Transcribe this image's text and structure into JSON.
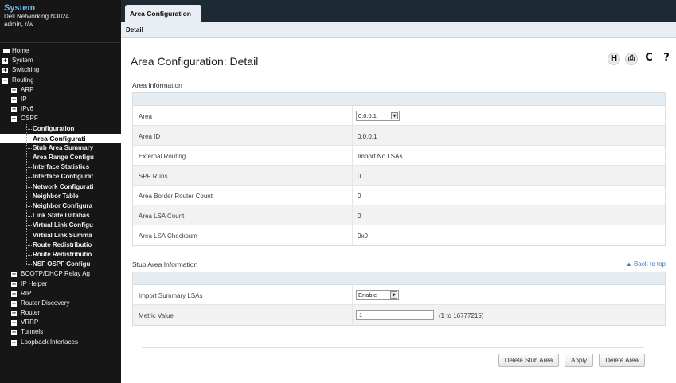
{
  "system": {
    "title": "System",
    "model": "Dell Networking N3024",
    "user": "admin, r/w"
  },
  "nav": {
    "items": [
      {
        "label": "Home",
        "expander": "",
        "level": 0
      },
      {
        "label": "System",
        "expander": "+",
        "level": 0
      },
      {
        "label": "Switching",
        "expander": "+",
        "level": 0
      },
      {
        "label": "Routing",
        "expander": "−",
        "level": 0
      },
      {
        "label": "ARP",
        "expander": "+",
        "level": 1
      },
      {
        "label": "IP",
        "expander": "+",
        "level": 1
      },
      {
        "label": "IPv6",
        "expander": "+",
        "level": 1
      },
      {
        "label": "OSPF",
        "expander": "−",
        "level": 1
      },
      {
        "label": "Configuration",
        "expander": "",
        "level": 2
      },
      {
        "label": "Area Configurati",
        "expander": "",
        "level": 2,
        "selected": true
      },
      {
        "label": "Stub Area Summary",
        "expander": "",
        "level": 2
      },
      {
        "label": "Area Range Configu",
        "expander": "",
        "level": 2
      },
      {
        "label": "Interface Statistics",
        "expander": "",
        "level": 2
      },
      {
        "label": "Interface Configurat",
        "expander": "",
        "level": 2
      },
      {
        "label": "Network Configurati",
        "expander": "",
        "level": 2
      },
      {
        "label": "Neighbor Table",
        "expander": "",
        "level": 2
      },
      {
        "label": "Neighbor Configura",
        "expander": "",
        "level": 2
      },
      {
        "label": "Link State Databas",
        "expander": "",
        "level": 2
      },
      {
        "label": "Virtual Link Configu",
        "expander": "",
        "level": 2
      },
      {
        "label": "Virtual Link Summa",
        "expander": "",
        "level": 2
      },
      {
        "label": "Route Redistributio",
        "expander": "",
        "level": 2
      },
      {
        "label": "Route Redistributio",
        "expander": "",
        "level": 2
      },
      {
        "label": "NSF OSPF Configu",
        "expander": "",
        "level": 2
      },
      {
        "label": "BOOTP/DHCP Relay Ag",
        "expander": "+",
        "level": 1
      },
      {
        "label": "IP Helper",
        "expander": "+",
        "level": 1
      },
      {
        "label": "RIP",
        "expander": "+",
        "level": 1
      },
      {
        "label": "Router Discovery",
        "expander": "+",
        "level": 1
      },
      {
        "label": "Router",
        "expander": "+",
        "level": 1
      },
      {
        "label": "VRRP",
        "expander": "+",
        "level": 1
      },
      {
        "label": "Tunnels",
        "expander": "+",
        "level": 1
      },
      {
        "label": "Loopback Interfaces",
        "expander": "+",
        "level": 1
      }
    ]
  },
  "tabs": {
    "main": "Area Configuration",
    "sub": "Detail"
  },
  "page": {
    "title": "Area Configuration: Detail"
  },
  "toolbar": {
    "icons": [
      "save-icon",
      "print-icon",
      "refresh-icon",
      "help-icon"
    ],
    "glyphs": [
      "H",
      "⎙",
      "C",
      "?"
    ]
  },
  "area_info": {
    "title": "Area Information",
    "rows": [
      {
        "label": "Area",
        "value": "0.0.0.1",
        "type": "select"
      },
      {
        "label": "Area ID",
        "value": "0.0.0.1"
      },
      {
        "label": "External Routing",
        "value": "Import No LSAs"
      },
      {
        "label": "SPF Runs",
        "value": "0"
      },
      {
        "label": "Area Border Router Count",
        "value": "0"
      },
      {
        "label": "Area LSA Count",
        "value": "0"
      },
      {
        "label": "Area LSA Checksum",
        "value": "0x0"
      }
    ]
  },
  "stub_info": {
    "title": "Stub Area Information",
    "back_to_top": "▲ Back to top",
    "rows": [
      {
        "label": "Import Summary LSAs",
        "value": "Enable",
        "type": "select"
      },
      {
        "label": "Metric Value",
        "value": "1",
        "type": "input",
        "hint": "(1 to 16777215)"
      }
    ]
  },
  "buttons": {
    "delete_stub": "Delete Stub Area",
    "apply": "Apply",
    "delete_area": "Delete Area"
  },
  "colors": {
    "sidebar_bg": "#161616",
    "system_title": "#6fb6e8",
    "topbar_dark": "#1e2a33",
    "tab_bg": "#e8eef3",
    "link": "#3a7fc1"
  }
}
